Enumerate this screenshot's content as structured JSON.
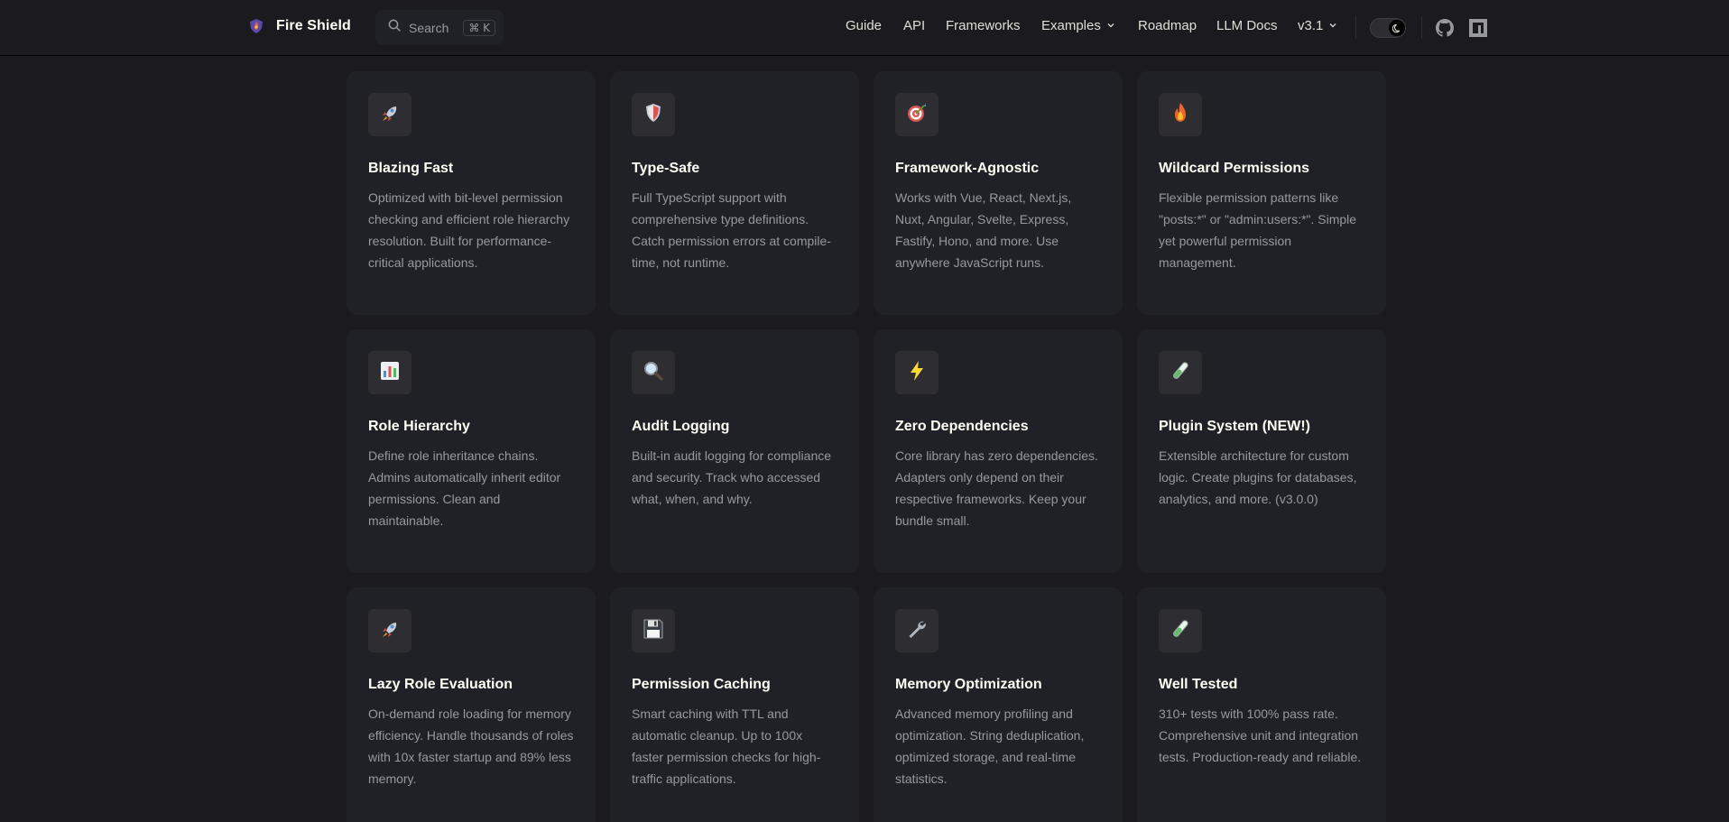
{
  "nav": {
    "brand": "Fire Shield",
    "search_label": "Search",
    "search_shortcut": "⌘ K",
    "links": {
      "guide": "Guide",
      "api": "API",
      "frameworks": "Frameworks",
      "examples": "Examples",
      "roadmap": "Roadmap",
      "llm_docs": "LLM Docs",
      "version": "v3.1"
    },
    "social": [
      "github-icon",
      "npm-icon"
    ]
  },
  "colors": {
    "background": "#1b1b1f",
    "card": "#202127",
    "icon_bg": "#2e2e32",
    "title": "#fffff5",
    "text": "#98989f"
  },
  "features": [
    {
      "icon": "rocket-icon",
      "title": "Blazing Fast",
      "details": "Optimized with bit-level permission checking and efficient role hierarchy resolution. Built for performance-critical applications."
    },
    {
      "icon": "shield-icon",
      "title": "Type-Safe",
      "details": "Full TypeScript support with comprehensive type definitions. Catch permission errors at compile-time, not runtime."
    },
    {
      "icon": "target-icon",
      "title": "Framework-Agnostic",
      "details": "Works with Vue, React, Next.js, Nuxt, Angular, Svelte, Express, Fastify, Hono, and more. Use anywhere JavaScript runs."
    },
    {
      "icon": "fire-icon",
      "title": "Wildcard Permissions",
      "details": "Flexible permission patterns like \"posts:*\" or \"admin:users:*\". Simple yet powerful permission management."
    },
    {
      "icon": "bar-chart-icon",
      "title": "Role Hierarchy",
      "details": "Define role inheritance chains. Admins automatically inherit editor permissions. Clean and maintainable."
    },
    {
      "icon": "magnifier-icon",
      "title": "Audit Logging",
      "details": "Built-in audit logging for compliance and security. Track who accessed what, when, and why."
    },
    {
      "icon": "lightning-icon",
      "title": "Zero Dependencies",
      "details": "Core library has zero dependencies. Adapters only depend on their respective frameworks. Keep your bundle small."
    },
    {
      "icon": "test-tube-icon",
      "title": "Plugin System (NEW!)",
      "details": "Extensible architecture for custom logic. Create plugins for databases, analytics, and more. (v3.0.0)"
    },
    {
      "icon": "rocket-icon",
      "title": "Lazy Role Evaluation",
      "details": "On-demand role loading for memory efficiency. Handle thousands of roles with 10x faster startup and 89% less memory."
    },
    {
      "icon": "floppy-disk-icon",
      "title": "Permission Caching",
      "details": "Smart caching with TTL and automatic cleanup. Up to 100x faster permission checks for high-traffic applications."
    },
    {
      "icon": "wrench-icon",
      "title": "Memory Optimization",
      "details": "Advanced memory profiling and optimization. String deduplication, optimized storage, and real-time statistics."
    },
    {
      "icon": "test-tube-icon",
      "title": "Well Tested",
      "details": "310+ tests with 100% pass rate. Comprehensive unit and integration tests. Production-ready and reliable."
    }
  ]
}
